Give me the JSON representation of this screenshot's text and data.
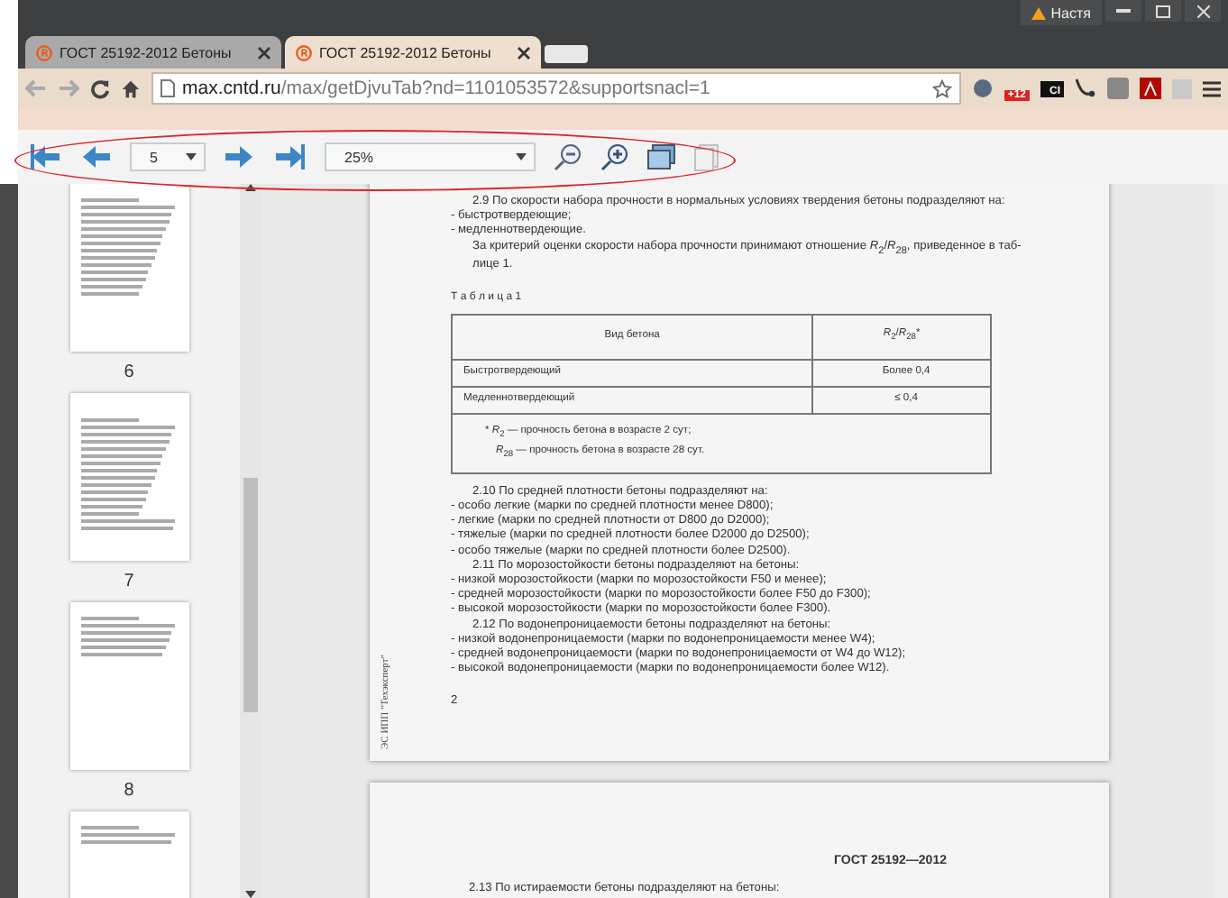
{
  "window": {
    "user": "Настя"
  },
  "tabs": [
    {
      "title": "ГОСТ 25192-2012 Бетоны",
      "selected": false
    },
    {
      "title": "ГОСТ 25192-2012 Бетоны",
      "selected": true
    }
  ],
  "address_bar": {
    "host": "max.cntd.ru",
    "path": "/max/getDjvuTab?nd=1101053572&supportsnacl=1"
  },
  "extensions": {
    "badge": "+12",
    "ci_label": "CI"
  },
  "viewer_toolbar": {
    "page": "5",
    "zoom": "25%",
    "pages_view_disabled": true
  },
  "thumbnails": [
    {
      "label": "6",
      "kind": "text"
    },
    {
      "label": "7",
      "kind": "title"
    },
    {
      "label": "8",
      "kind": "short"
    },
    {
      "kind": "form"
    }
  ],
  "page_1": {
    "paragraphs": [
      {
        "kind": "indent",
        "lines": [
          "2.9 По скорости набора прочности в нормальных условиях твердения бетоны подразделяют на:"
        ]
      },
      {
        "kind": "plain",
        "lines": [
          "- быстротвердеющие;"
        ]
      },
      {
        "kind": "plain",
        "lines": [
          "- медленнотвердеющие."
        ]
      },
      {
        "kind": "indent",
        "lines": [
          "За критерий оценки скорости набора прочности принимают отношение *R*$_{2}$/*R*$_{28}$, приведенное в таб-",
          "лице 1."
        ]
      }
    ],
    "table_caption": "Т а б л и ц а 1",
    "table": {
      "columns": [
        "Вид бетона",
        "*R*$_{2}$/*R*$_{28}$*"
      ],
      "rows": [
        [
          "Быстротвердеющий",
          "Более 0,4"
        ],
        [
          "Медленнотвердеющий",
          "≤ 0,4"
        ]
      ],
      "footnote": [
        "* *R*$_{2}$ — прочность бетона в возрасте 2 сут;",
        "*R*$_{28}$ — прочность бетона в возрасте 28 сут."
      ]
    },
    "list": [
      {
        "kind": "heading",
        "text": "2.10 По средней плотности бетоны подразделяют на:"
      },
      {
        "kind": "item",
        "text": "- особо легкие (марки по средней плотности менее D800);"
      },
      {
        "kind": "item",
        "text": "- легкие (марки по средней плотности от D800 до D2000);"
      },
      {
        "kind": "item",
        "text": "- тяжелые (марки по средней плотности более D2000 до D2500);"
      },
      {
        "kind": "item",
        "text": "- особо тяжелые (марки по средней плотности более D2500)."
      },
      {
        "kind": "heading",
        "text": "2.11 По морозостойкости бетоны подразделяют на бетоны:"
      },
      {
        "kind": "item",
        "text": "- низкой морозостойкости (марки по морозостойкости F50 и менее);"
      },
      {
        "kind": "item",
        "text": "- средней морозостойкости (марки по морозостойкости более F50 до F300);"
      },
      {
        "kind": "item",
        "text": "- высокой морозостойкости (марки по морозостойкости более F300)."
      },
      {
        "kind": "heading",
        "text": "2.12 По водонепроницаемости бетоны подразделяют на бетоны:"
      },
      {
        "kind": "item",
        "text": "- низкой водонепроницаемости (марки по водонепроницаемости менее W4);"
      },
      {
        "kind": "item",
        "text": "- средней водонепроницаемости (марки по водонепроницаемости от W4 до W12);"
      },
      {
        "kind": "item",
        "text": "- высокой водонепроницаемости (марки по водонепроницаемости более W12)."
      }
    ],
    "page_number": "2",
    "side_note": "ЭС ИПП \"Техэксперт\""
  },
  "page_2": {
    "header": "ГОСТ 25192—2012",
    "first_line": "2.13 По истираемости бетоны подразделяют на бетоны:"
  }
}
